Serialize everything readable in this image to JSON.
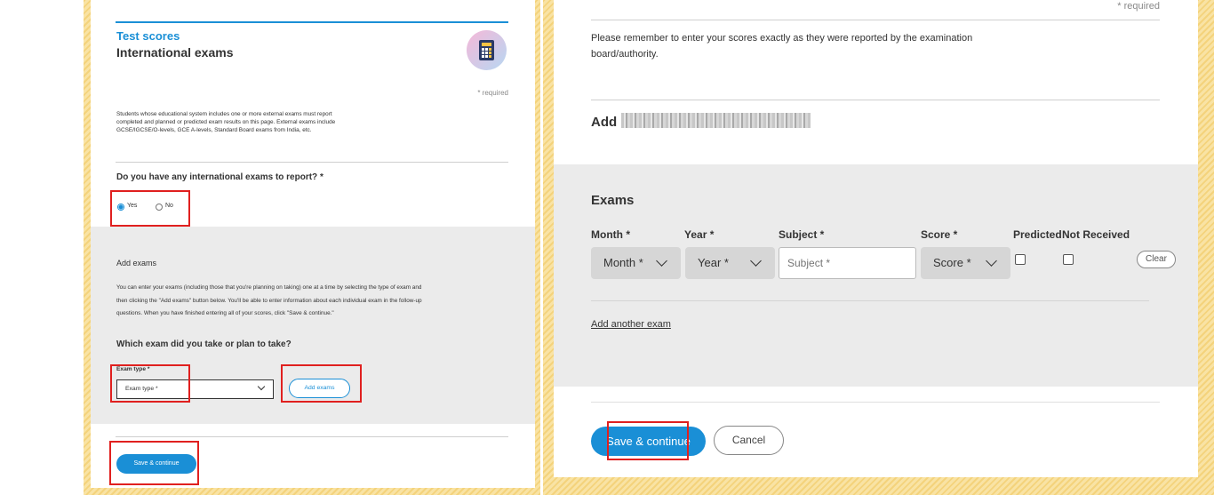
{
  "left": {
    "section_kicker": "Test scores",
    "section_title": "International exams",
    "required_note": "* required",
    "intro_line1": "Students whose educational system includes one or more external exams must report",
    "intro_line2": "completed and planned or predicted exam results on this page. External exams include",
    "intro_line3": "GCSE/IGCSE/O-levels, GCE A-levels, Standard Board exams from India, etc.",
    "question": "Do you have any international exams to report? *",
    "radio_yes": "Yes",
    "radio_no": "No",
    "add_exams_heading": "Add exams",
    "add_exams_line1": "You can enter your exams (including those that you're planning on taking) one at a time by selecting the type of exam and",
    "add_exams_line2": "then clicking the \"Add exams\" button below. You'll be able to enter information about each individual exam in the follow-up",
    "add_exams_line3": "questions. When you have finished entering all of your scores, click \"Save & continue.\"",
    "which_exam_question": "Which exam did you take or plan to take?",
    "exam_type_label": "Exam type *",
    "exam_type_value": "Exam type *",
    "add_exams_button": "Add exams",
    "save_button": "Save & continue"
  },
  "right": {
    "required_note": "* required",
    "reminder_line1": "Please remember to enter your scores exactly as they were reported by the examination",
    "reminder_line2": "board/authority.",
    "add_heading": "Add",
    "exams_heading": "Exams",
    "columns": [
      "Month *",
      "Year *",
      "Subject *",
      "Score *",
      "Predicted",
      "Not Received"
    ],
    "month_select": "Month *",
    "year_select": "Year *",
    "subject_placeholder": "Subject *",
    "score_select": "Score *",
    "clear_button": "Clear",
    "add_another_link": "Add another exam",
    "save_button": "Save & continue",
    "cancel_button": "Cancel"
  },
  "colors": {
    "accent_blue": "#1a8fd6",
    "highlight_red": "#e0201f",
    "panel_grey": "#ebebeb"
  },
  "icons": {
    "section_icon": "calculator-icon"
  }
}
